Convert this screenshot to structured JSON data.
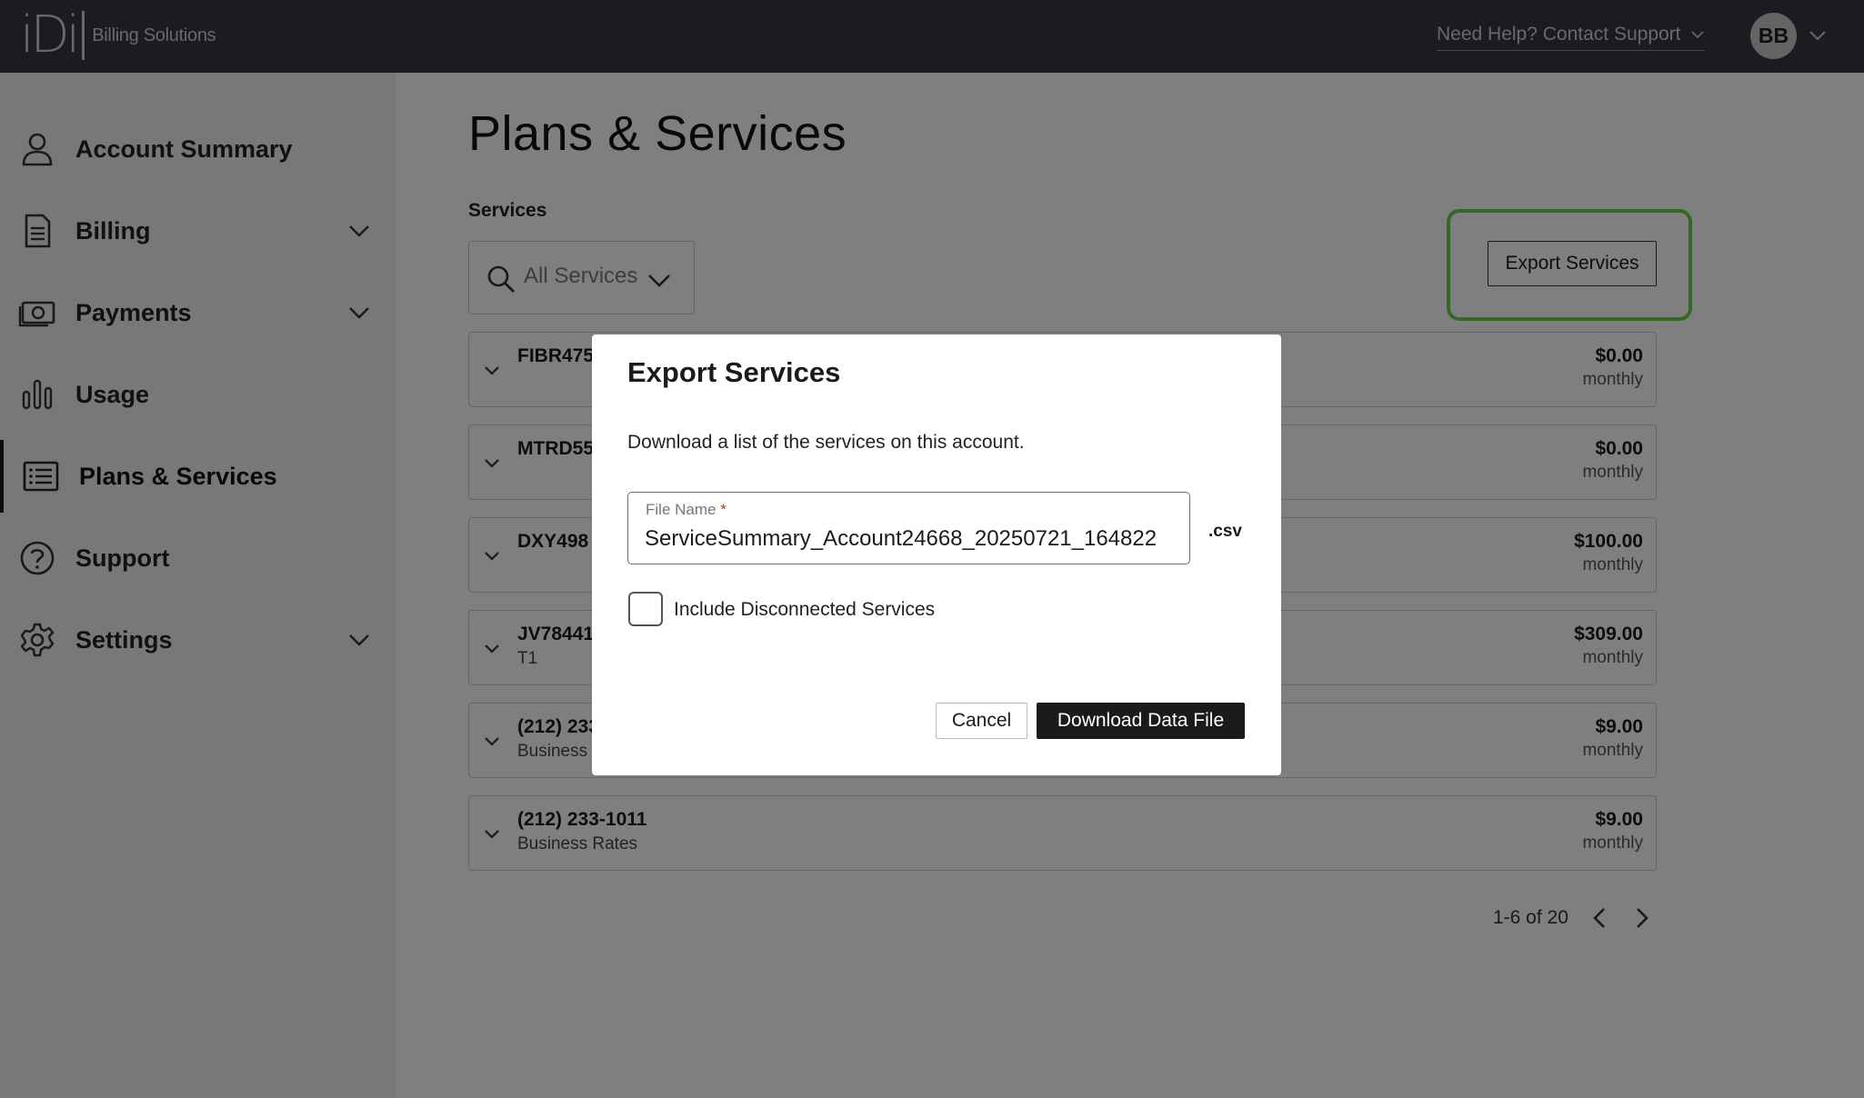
{
  "header": {
    "logo_mark": "iDi",
    "logo_text": "Billing Solutions",
    "help_label": "Need Help? Contact Support",
    "avatar_initials": "BB"
  },
  "sidebar": {
    "items": [
      {
        "label": "Account Summary",
        "icon": "person-icon",
        "has_caret": false,
        "active": false
      },
      {
        "label": "Billing",
        "icon": "document-icon",
        "has_caret": true,
        "active": false
      },
      {
        "label": "Payments",
        "icon": "cash-icon",
        "has_caret": true,
        "active": false
      },
      {
        "label": "Usage",
        "icon": "bar-chart-icon",
        "has_caret": false,
        "active": false
      },
      {
        "label": "Plans & Services",
        "icon": "list-icon",
        "has_caret": false,
        "active": true
      },
      {
        "label": "Support",
        "icon": "question-icon",
        "has_caret": false,
        "active": false
      },
      {
        "label": "Settings",
        "icon": "gear-icon",
        "has_caret": true,
        "active": false
      }
    ]
  },
  "main": {
    "title": "Plans & Services",
    "services_label": "Services",
    "filter_value": "All Services",
    "export_button": "Export Services",
    "services": [
      {
        "name": "FIBR475",
        "sub": "",
        "price": "$0.00",
        "period": "monthly"
      },
      {
        "name": "MTRD55",
        "sub": "",
        "price": "$0.00",
        "period": "monthly"
      },
      {
        "name": "DXY498",
        "sub": "",
        "price": "$100.00",
        "period": "monthly"
      },
      {
        "name": "JV78441",
        "sub": "T1",
        "price": "$309.00",
        "period": "monthly"
      },
      {
        "name": "(212) 233",
        "sub": "Business",
        "price": "$9.00",
        "period": "monthly"
      },
      {
        "name": "(212) 233-1011",
        "sub": "Business Rates",
        "price": "$9.00",
        "period": "monthly"
      }
    ],
    "pagination": "1-6 of 20"
  },
  "modal": {
    "title": "Export Services",
    "description": "Download a list of the services on this account.",
    "file_label": "File Name",
    "required_mark": "*",
    "file_value": "ServiceSummary_Account24668_20250721_164822",
    "extension": ".csv",
    "include_disconnected_label": "Include Disconnected Services",
    "include_disconnected_checked": false,
    "cancel_label": "Cancel",
    "download_label": "Download Data File"
  },
  "colors": {
    "topbar": "#34393e",
    "highlight": "#69d14b",
    "primary_button": "#1b1b1b"
  }
}
